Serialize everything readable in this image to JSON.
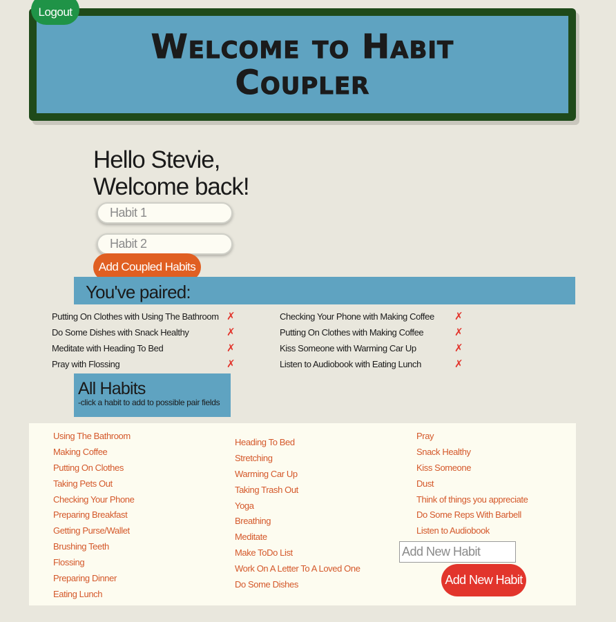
{
  "header": {
    "logout_label": "Logout",
    "title": "Welcome to Habit Coupler"
  },
  "greeting": {
    "line1": "Hello Stevie,",
    "line2": "Welcome back!"
  },
  "pair_form": {
    "habit1_placeholder": "Habit 1",
    "habit2_placeholder": "Habit 2",
    "submit_label": "Add Coupled Habits"
  },
  "paired": {
    "heading": "You've paired:",
    "remove_symbol": "✗",
    "left": [
      "Putting On Clothes with Using The Bathroom",
      "Do Some Dishes with Snack Healthy",
      "Meditate with Heading To Bed",
      "Pray with Flossing"
    ],
    "right": [
      "Checking Your Phone with Making Coffee",
      "Putting On Clothes with Making Coffee",
      "Kiss Someone with Warming Car Up",
      "Listen to Audiobook with Eating Lunch"
    ]
  },
  "all_habits": {
    "heading": "All Habits",
    "hint": "-click a habit to add to possible pair fields",
    "col1": [
      "Using The Bathroom",
      "Making Coffee",
      "Putting On Clothes",
      "Taking Pets Out",
      "Checking Your Phone",
      "Preparing Breakfast",
      "Getting Purse/Wallet",
      "Brushing Teeth",
      "Flossing",
      "Preparing Dinner",
      "Eating Lunch"
    ],
    "col2": [
      "Heading To Bed",
      "Stretching",
      "Warming Car Up",
      "Taking Trash Out",
      "Yoga",
      "Breathing",
      "Meditate",
      "Make ToDo List",
      "Work On A Letter To A Loved One",
      "Do Some Dishes"
    ],
    "col3": [
      "Pray",
      "Snack Healthy",
      "Kiss Someone",
      "Dust",
      "Think of things you appreciate",
      "Do Some Reps With Barbell",
      "Listen to Audiobook"
    ],
    "new_habit_placeholder": "Add New Habit",
    "new_habit_button": "Add New Habit"
  },
  "colors": {
    "background": "#e9e7dd",
    "banner_border": "#1f4a1a",
    "banner_fill": "#5fa3c1",
    "logout": "#1f9347",
    "add_coupled": "#e05f22",
    "add_new_habit": "#e2352c",
    "habit_link": "#d4582a",
    "remove_x": "#e2352c"
  }
}
